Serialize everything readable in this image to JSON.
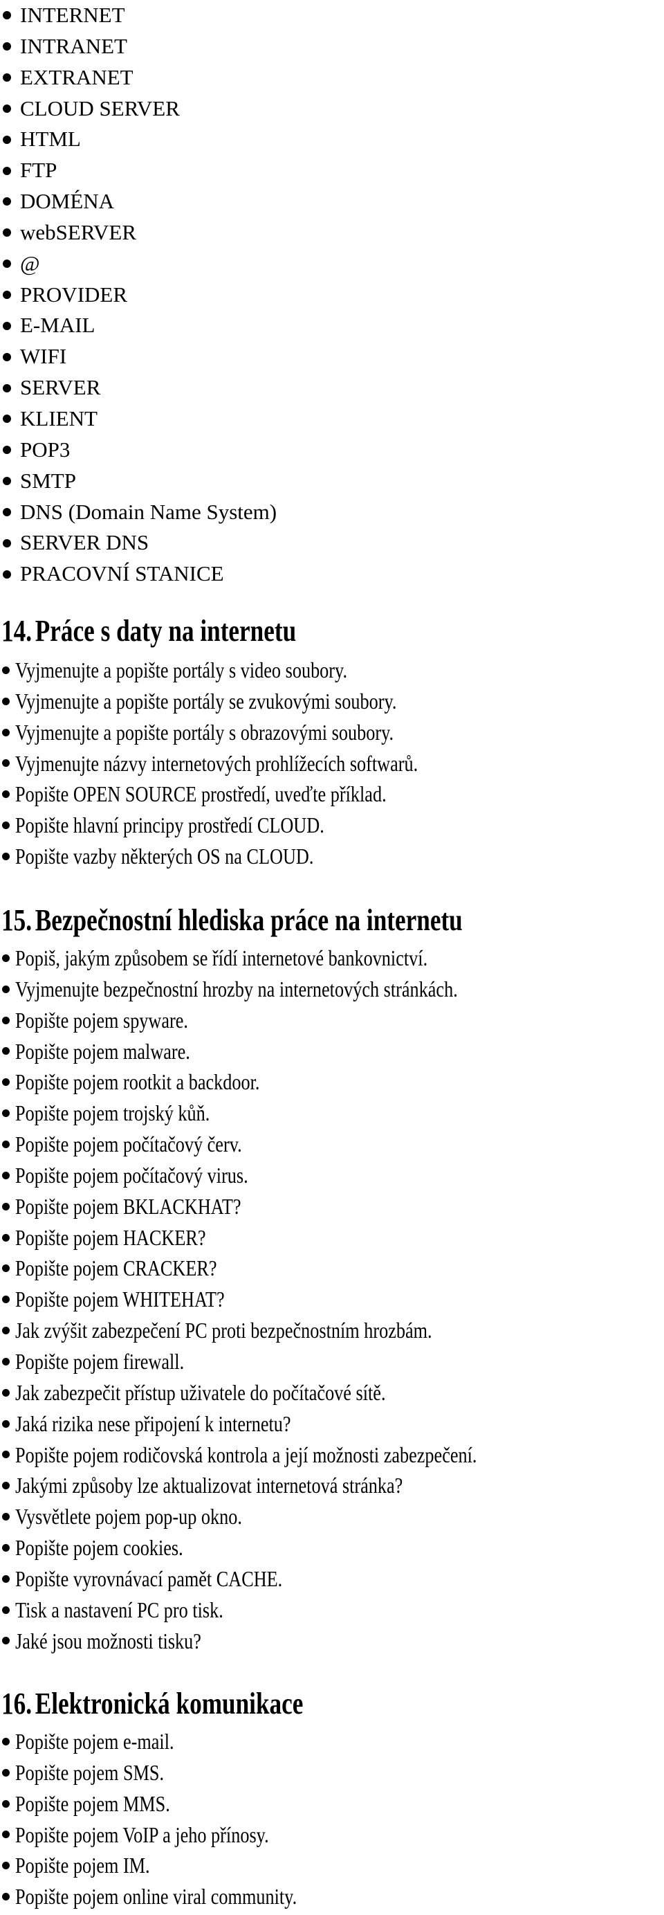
{
  "terms": [
    "INTERNET",
    "INTRANET",
    "EXTRANET",
    "CLOUD SERVER",
    "HTML",
    "FTP",
    "DOMÉNA",
    "webSERVER",
    "@",
    "PROVIDER",
    "E-MAIL",
    "WIFI",
    "SERVER",
    "KLIENT",
    "POP3",
    "SMTP",
    "DNS (Domain Name System)",
    "SERVER DNS",
    "PRACOVNÍ STANICE"
  ],
  "sections": [
    {
      "number": "14.",
      "title": "Práce s daty na internetu",
      "items": [
        "Vyjmenujte a popište portály s video soubory.",
        "Vyjmenujte a popište portály se zvukovými soubory.",
        "Vyjmenujte a popište portály s obrazovými soubory.",
        "Vyjmenujte názvy internetových prohlížecích softwarů.",
        "Popište OPEN SOURCE prostředí, uveďte příklad.",
        "Popište hlavní principy prostředí CLOUD.",
        "Popište vazby některých OS na CLOUD."
      ]
    },
    {
      "number": "15.",
      "title": "Bezpečnostní hlediska práce na internetu",
      "items": [
        "Popiš, jakým způsobem se řídí internetové bankovnictví.",
        "Vyjmenujte bezpečnostní hrozby na internetových stránkách.",
        "Popište pojem spyware.",
        "Popište pojem malware.",
        "Popište pojem rootkit a backdoor.",
        "Popište pojem trojský kůň.",
        "Popište pojem počítačový červ.",
        "Popište pojem počítačový virus.",
        "Popište pojem BKLACKHAT?",
        "Popište pojem HACKER?",
        "Popište pojem CRACKER?",
        "Popište pojem WHITEHAT?",
        "Jak zvýšit zabezpečení PC proti bezpečnostním hrozbám.",
        "Popište pojem firewall.",
        "Jak zabezpečit přístup uživatele do počítačové sítě.",
        "Jaká rizika nese připojení k internetu?",
        "Popište pojem rodičovská kontrola a její možnosti zabezpečení.",
        "Jakými způsoby lze aktualizovat internetová stránka?",
        "Vysvětlete pojem pop-up okno.",
        "Popište pojem cookies.",
        "Popište vyrovnávací pamět CACHE.",
        "Tisk a nastavení PC pro tisk.",
        "Jaké jsou možnosti tisku?"
      ]
    },
    {
      "number": "16.",
      "title": "Elektronická komunikace",
      "items": [
        "Popište pojem e-mail.",
        "Popište pojem SMS.",
        "Popište pojem MMS.",
        "Popište pojem VoIP a jeho přínosy.",
        "Popište pojem IM.",
        "Popište pojem online viral community."
      ]
    }
  ]
}
